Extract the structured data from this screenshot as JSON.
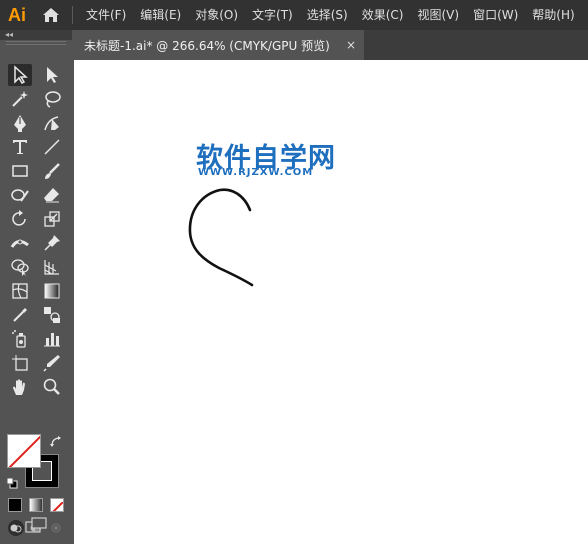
{
  "menubar": {
    "app_logo": "Ai",
    "items": [
      "文件(F)",
      "编辑(E)",
      "对象(O)",
      "文字(T)",
      "选择(S)",
      "效果(C)",
      "视图(V)",
      "窗口(W)",
      "帮助(H)"
    ]
  },
  "tab": {
    "title": "未标题-1.ai* @ 266.64% (CMYK/GPU 预览)",
    "close": "×"
  },
  "panel": {
    "collapse_label": "◂◂"
  },
  "canvas": {
    "watermark_title": "软件自学网",
    "watermark_sub": "WWW.RJZXW.COM"
  },
  "colors": {
    "accent_logo": "#ff9a00",
    "watermark": "#1f6fbf",
    "panel_bg": "#535353",
    "menubar_bg": "#323232"
  },
  "tools": [
    "selection-tool",
    "direct-selection-tool",
    "magic-wand-tool",
    "lasso-tool",
    "pen-tool",
    "curvature-tool",
    "type-tool",
    "line-segment-tool",
    "rectangle-tool",
    "paintbrush-tool",
    "shaper-tool",
    "eraser-tool",
    "rotate-tool",
    "scale-tool",
    "width-tool",
    "puppet-warp-tool",
    "shape-builder-tool",
    "perspective-grid-tool",
    "mesh-tool",
    "gradient-tool",
    "eyedropper-tool",
    "blend-tool",
    "symbol-sprayer-tool",
    "column-graph-tool",
    "artboard-tool",
    "slice-tool",
    "hand-tool",
    "zoom-tool"
  ]
}
